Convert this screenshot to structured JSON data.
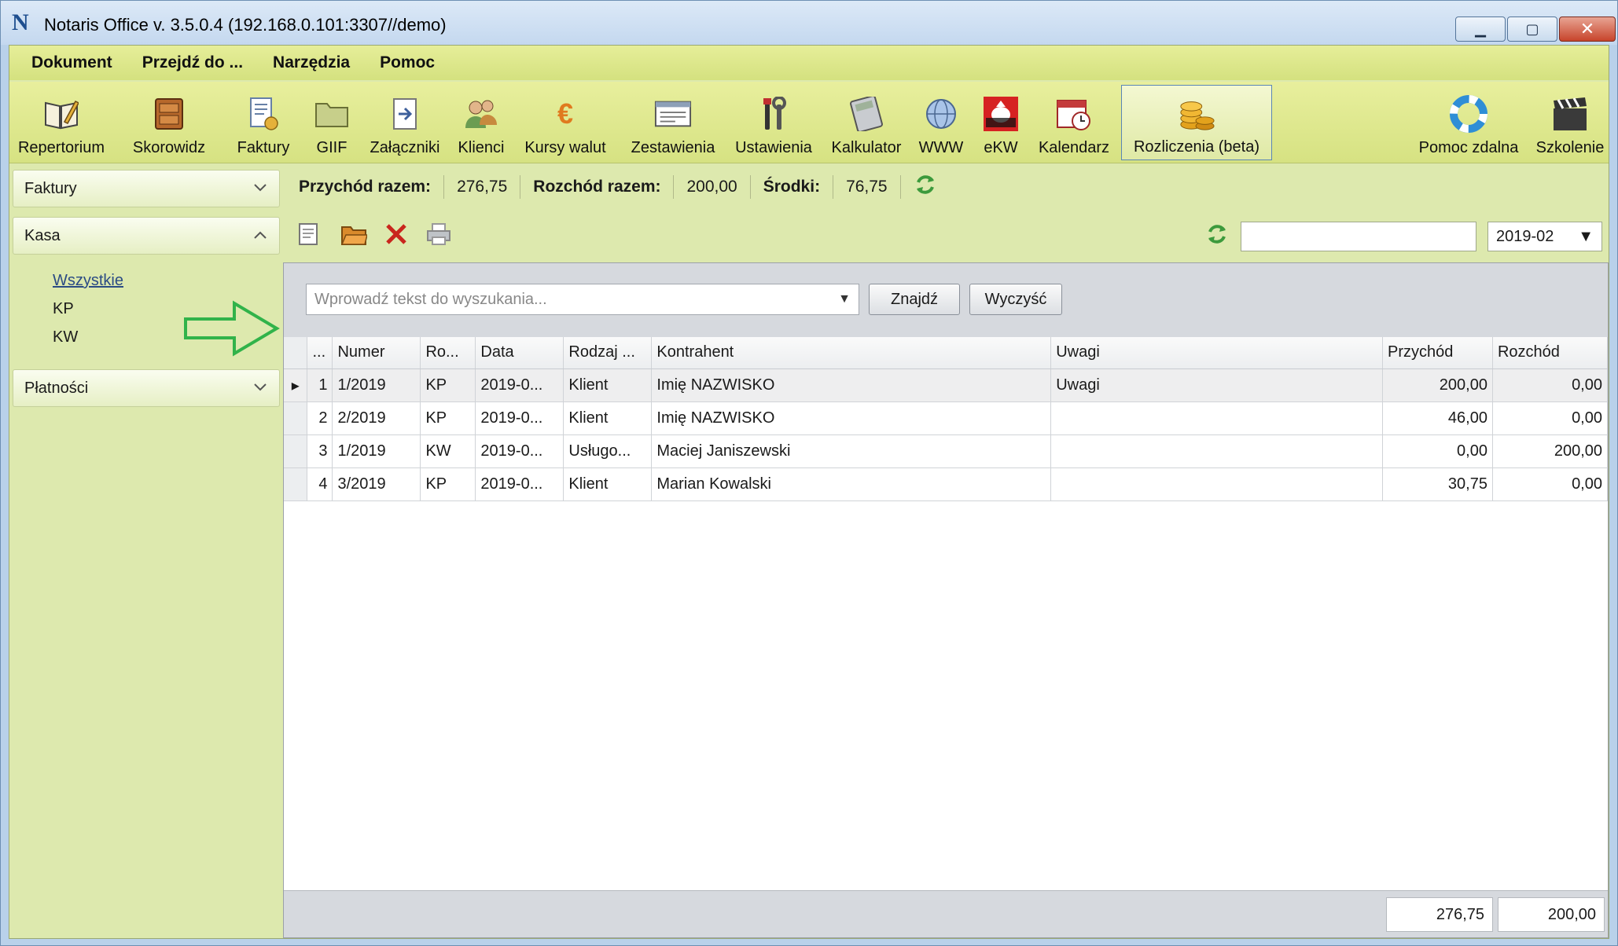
{
  "window": {
    "title": "Notaris Office v. 3.5.0.4 (192.168.0.101:3307//demo)",
    "app_icon": "N",
    "minimize": "▁",
    "maximize": "▢",
    "close": "✕"
  },
  "menu": [
    "Dokument",
    "Przejdź do ...",
    "Narzędzia",
    "Pomoc"
  ],
  "toolbar": [
    {
      "label": "Repertorium",
      "icon": "book-pen-icon"
    },
    {
      "label": "Skorowidz",
      "icon": "cabinet-icon"
    },
    {
      "label": "Faktury",
      "icon": "invoice-icon"
    },
    {
      "label": "GIIF",
      "icon": "folder-icon"
    },
    {
      "label": "Załączniki",
      "icon": "attachment-icon"
    },
    {
      "label": "Klienci",
      "icon": "clients-icon"
    },
    {
      "label": "Kursy walut",
      "icon": "euro-icon"
    },
    {
      "label": "Zestawienia",
      "icon": "report-icon"
    },
    {
      "label": "Ustawienia",
      "icon": "tools-icon"
    },
    {
      "label": "Kalkulator",
      "icon": "calculator-icon"
    },
    {
      "label": "WWW",
      "icon": "globe-icon"
    },
    {
      "label": "eKW",
      "icon": "ekw-icon"
    },
    {
      "label": "Kalendarz",
      "icon": "calendar-icon"
    },
    {
      "label": "Rozliczenia (beta)",
      "icon": "coins-icon",
      "active": true
    },
    {
      "label": "Pomoc zdalna",
      "icon": "lifebuoy-icon"
    },
    {
      "label": "Szkolenie",
      "icon": "clapperboard-icon"
    }
  ],
  "sidebar": {
    "sections": [
      "Faktury",
      "Kasa",
      "Płatności"
    ],
    "kasa_items": [
      "Wszystkie",
      "KP",
      "KW"
    ]
  },
  "summary": {
    "income_label": "Przychód razem:",
    "income_value": "276,75",
    "expense_label": "Rozchód razem:",
    "expense_value": "200,00",
    "funds_label": "Środki:",
    "funds_value": "76,75"
  },
  "period": "2019-02",
  "search": {
    "placeholder": "Wprowadź tekst do wyszukania...",
    "find": "Znajdź",
    "clear": "Wyczyść"
  },
  "table": {
    "headers": [
      "...",
      "Numer",
      "Ro...",
      "Data",
      "Rodzaj ...",
      "Kontrahent",
      "Uwagi",
      "Przychód",
      "Rozchód"
    ],
    "rows": [
      [
        "1",
        "1/2019",
        "KP",
        "2019-0...",
        "Klient",
        "Imię NAZWISKO",
        "Uwagi",
        "200,00",
        "0,00"
      ],
      [
        "2",
        "2/2019",
        "KP",
        "2019-0...",
        "Klient",
        "Imię NAZWISKO",
        "",
        "46,00",
        "0,00"
      ],
      [
        "3",
        "1/2019",
        "KW",
        "2019-0...",
        "Usługo...",
        "Maciej  Janiszewski",
        "",
        "0,00",
        "200,00"
      ],
      [
        "4",
        "3/2019",
        "KP",
        "2019-0...",
        "Klient",
        "Marian Kowalski",
        "",
        "30,75",
        "0,00"
      ]
    ],
    "total_income": "276,75",
    "total_expense": "200,00"
  }
}
